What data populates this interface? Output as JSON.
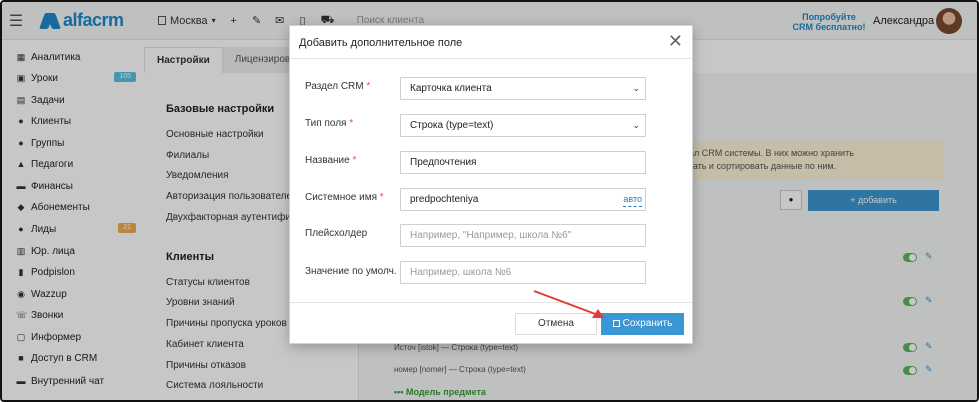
{
  "topbar": {
    "logo": "alfacrm",
    "branch": "Москва",
    "search_placeholder": "Поиск клиента",
    "promo_line1": "Попробуйте",
    "promo_line2": "CRM бесплатно!",
    "user_name": "Александра"
  },
  "sidebar": {
    "items": [
      {
        "label": "Аналитика",
        "icon": "chart-icon"
      },
      {
        "label": "Уроки",
        "icon": "calendar-icon",
        "badge": "105",
        "badge_color": "#5bc0de"
      },
      {
        "label": "Задачи",
        "icon": "tasks-icon"
      },
      {
        "label": "Клиенты",
        "icon": "user-icon"
      },
      {
        "label": "Группы",
        "icon": "users-icon"
      },
      {
        "label": "Педагоги",
        "icon": "graduation-icon"
      },
      {
        "label": "Финансы",
        "icon": "money-icon"
      },
      {
        "label": "Абонементы",
        "icon": "tag-icon"
      },
      {
        "label": "Лиды",
        "icon": "user-plus-icon",
        "badge": "21",
        "badge_color": "#f0ad4e"
      },
      {
        "label": "Юр. лица",
        "icon": "building-icon"
      },
      {
        "label": "Podpislon",
        "icon": "file-icon"
      },
      {
        "label": "Wazzup",
        "icon": "whatsapp-icon"
      },
      {
        "label": "Звонки",
        "icon": "phone-icon"
      },
      {
        "label": "Информер",
        "icon": "window-icon"
      },
      {
        "label": "Доступ в CRM",
        "icon": "lock-icon"
      },
      {
        "label": "Внутренний чат",
        "icon": "chat-icon"
      }
    ]
  },
  "tabs": [
    "Настройки",
    "Лицензирование"
  ],
  "settings": {
    "basic_title": "Базовые настройки",
    "basic_links": [
      "Основные настройки",
      "Филиалы",
      "Уведомления",
      "Авторизация пользователей",
      "Двухфакторная аутентификация"
    ],
    "clients_title": "Клиенты",
    "clients_links": [
      "Статусы клиентов",
      "Уровни знаний",
      "Причины пропуска уроков",
      "Кабинет клиента",
      "Причины отказов",
      "Система лояльности"
    ]
  },
  "panel": {
    "warn_line1": "ионал CRM системы. В них можно хранить",
    "warn_line2": "тровать и сортировать данные по ним.",
    "add_button": "+ добавить",
    "rows": [
      "Источ [istok] — Строка (type=text)",
      "номер [nomer] — Строка (type=text)"
    ],
    "model_link": "••• Модель предмета"
  },
  "modal": {
    "title": "Добавить дополнительное поле",
    "close": "✕",
    "fields": {
      "section_label": "Раздел CRM",
      "section_value": "Карточка клиента",
      "type_label": "Тип поля",
      "type_value": "Строка (type=text)",
      "name_label": "Название",
      "name_value": "Предпочтения",
      "sysname_label": "Системное имя",
      "sysname_value": "predpochteniya",
      "sysname_auto": "авто",
      "placeholder_label": "Плейсхолдер",
      "placeholder_ph": "Например, \"Например, школа №6\"",
      "default_label": "Значение по умолч.",
      "default_ph": "Например, школа №6"
    },
    "required_mark": "*",
    "cancel": "Отмена",
    "save": "Сохранить"
  },
  "colors": {
    "accent": "#3b97d3",
    "required": "#d9534f",
    "arrow": "#e53935"
  }
}
